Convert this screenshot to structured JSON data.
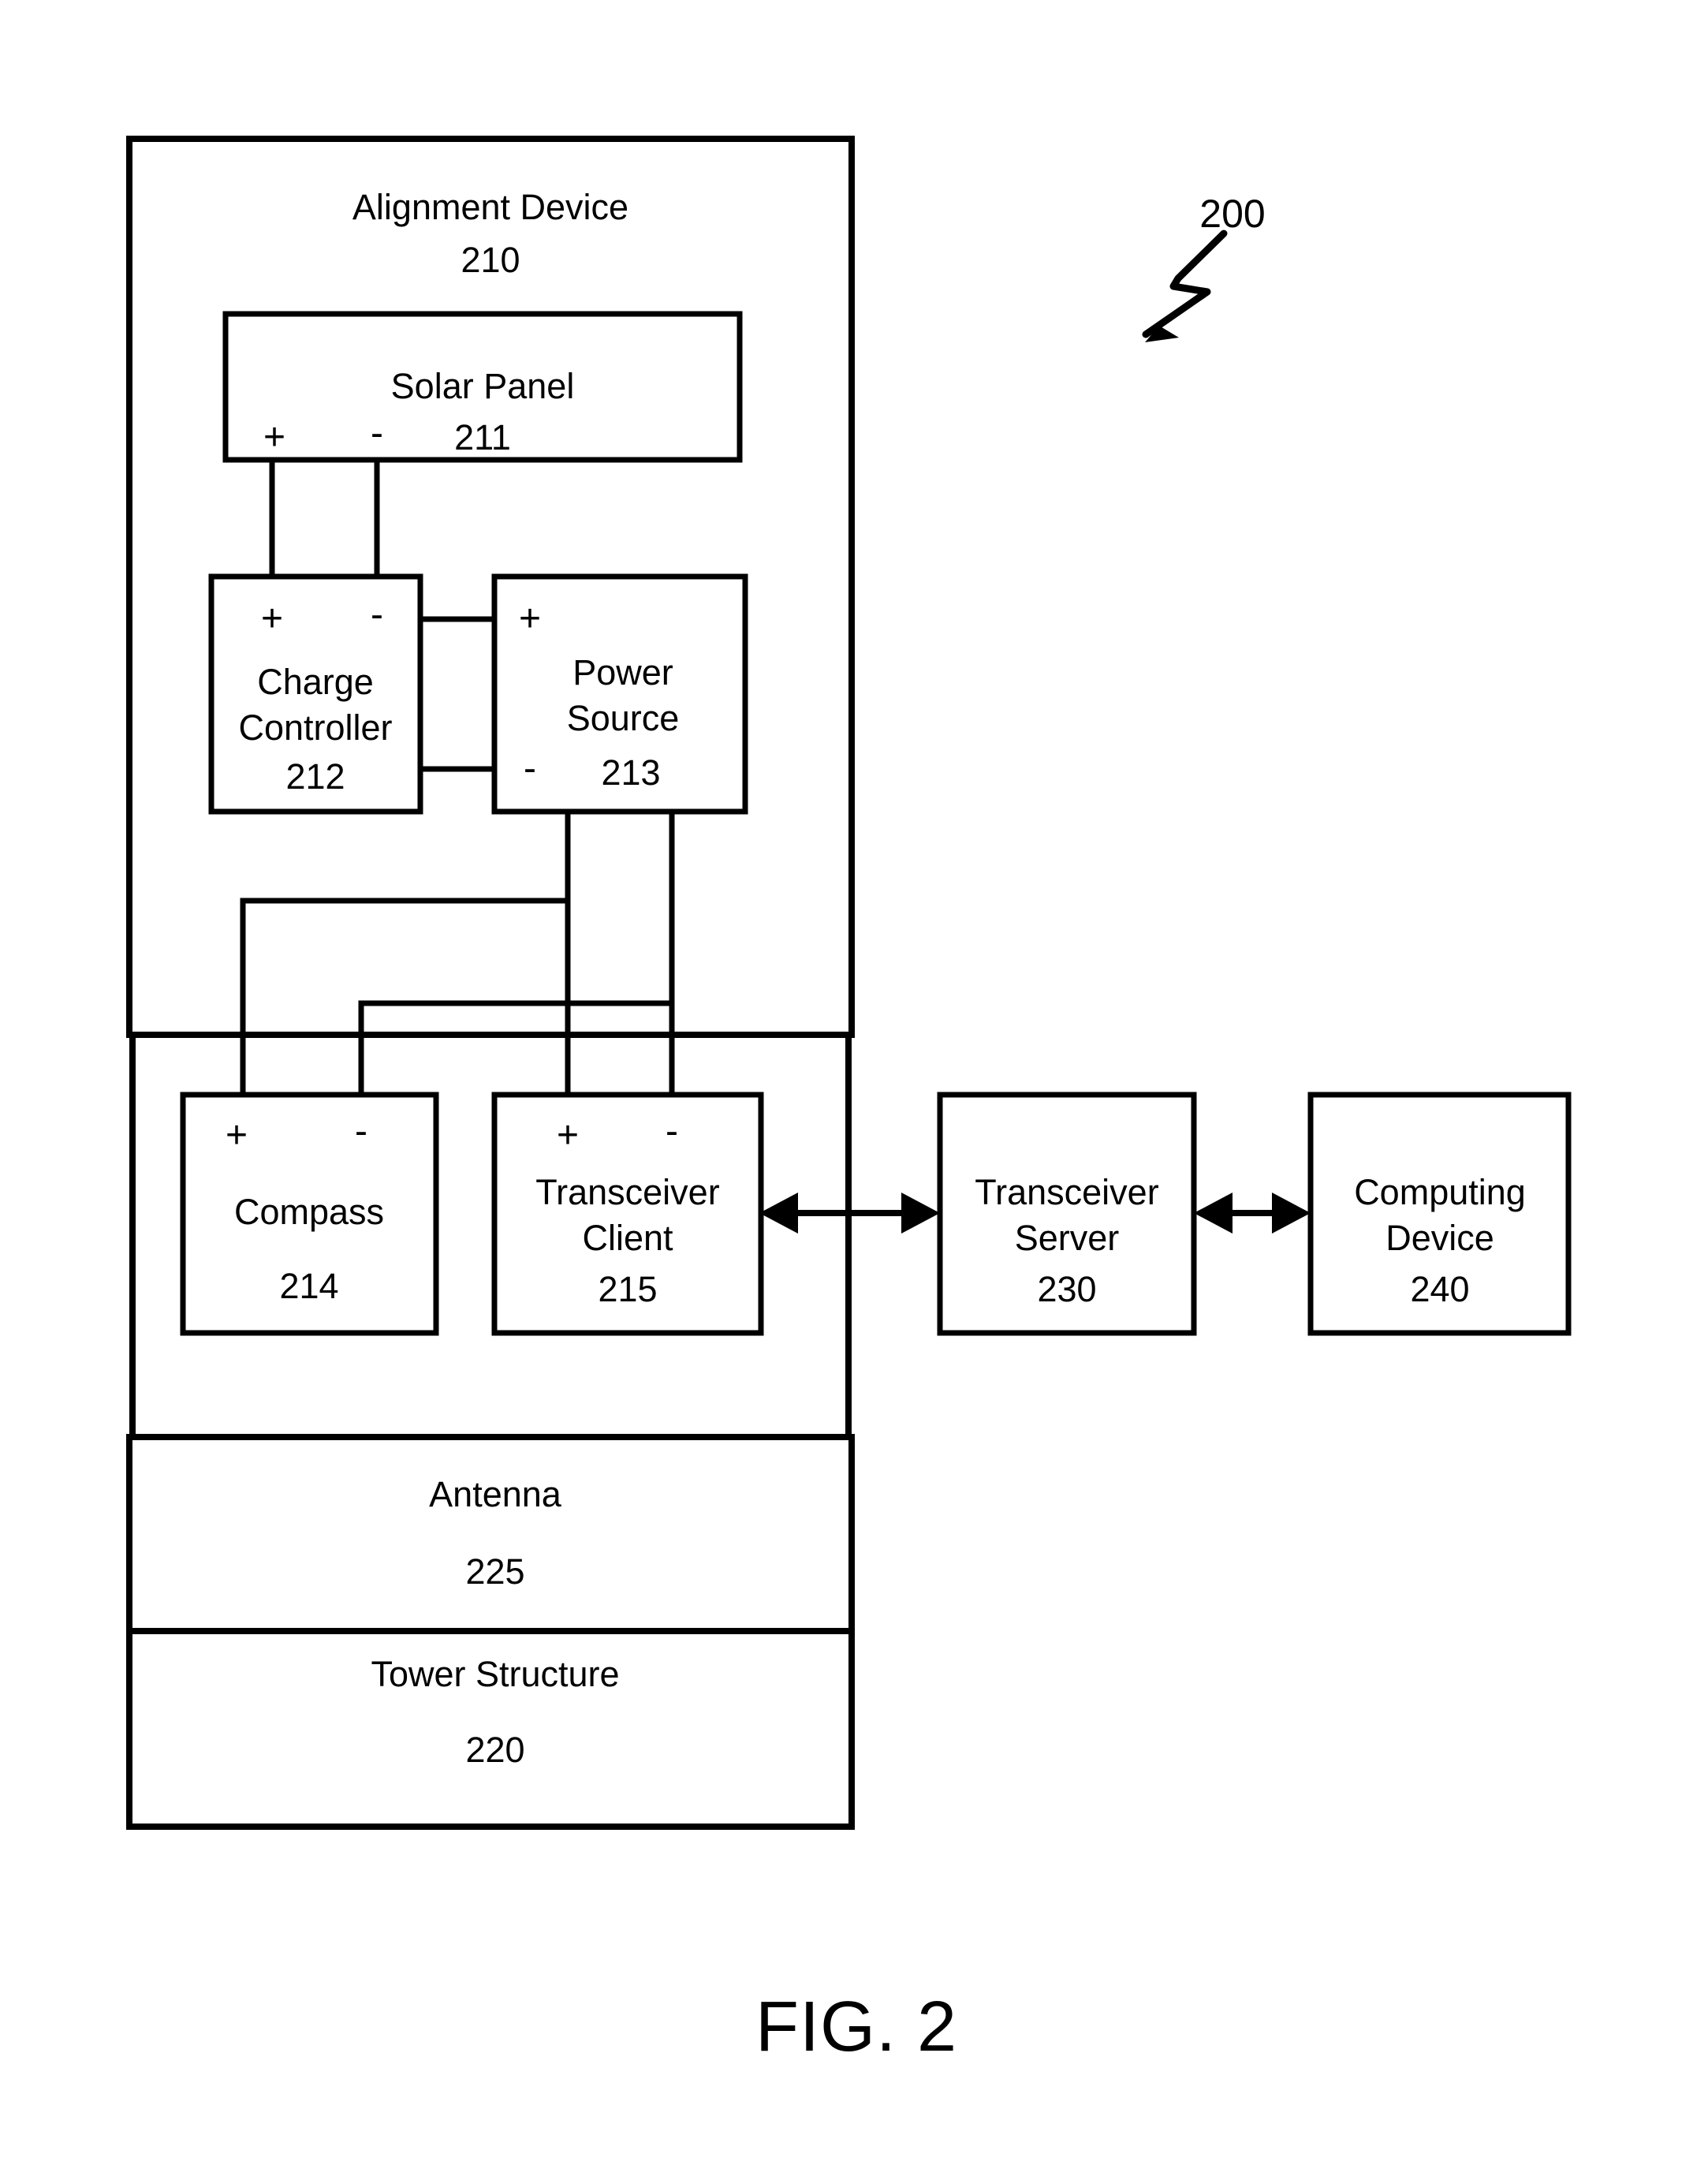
{
  "figure": {
    "caption": "FIG. 2",
    "reference_label": "200"
  },
  "container": {
    "title": "Alignment Device",
    "number": "210",
    "sections": [
      {
        "name": "Antenna",
        "number": "225"
      },
      {
        "name": "Tower Structure",
        "number": "220"
      }
    ]
  },
  "blocks": {
    "solar_panel": {
      "name": "Solar Panel",
      "number": "211",
      "plus": "+",
      "minus": "-"
    },
    "charge_controller": {
      "name_line1": "Charge",
      "name_line2": "Controller",
      "number": "212",
      "plus": "+",
      "minus": "-"
    },
    "power_source": {
      "name_line1": "Power",
      "name_line2": "Source",
      "number": "213",
      "plus": "+",
      "minus": "-"
    },
    "compass": {
      "name": "Compass",
      "number": "214",
      "plus": "+",
      "minus": "-"
    },
    "transceiver_client": {
      "name_line1": "Transceiver",
      "name_line2": "Client",
      "number": "215",
      "plus": "+",
      "minus": "-"
    },
    "transceiver_server": {
      "name_line1": "Transceiver",
      "name_line2": "Server",
      "number": "230"
    },
    "computing_device": {
      "name_line1": "Computing",
      "name_line2": "Device",
      "number": "240"
    }
  },
  "colors": {
    "stroke": "#000000",
    "background": "#ffffff"
  }
}
